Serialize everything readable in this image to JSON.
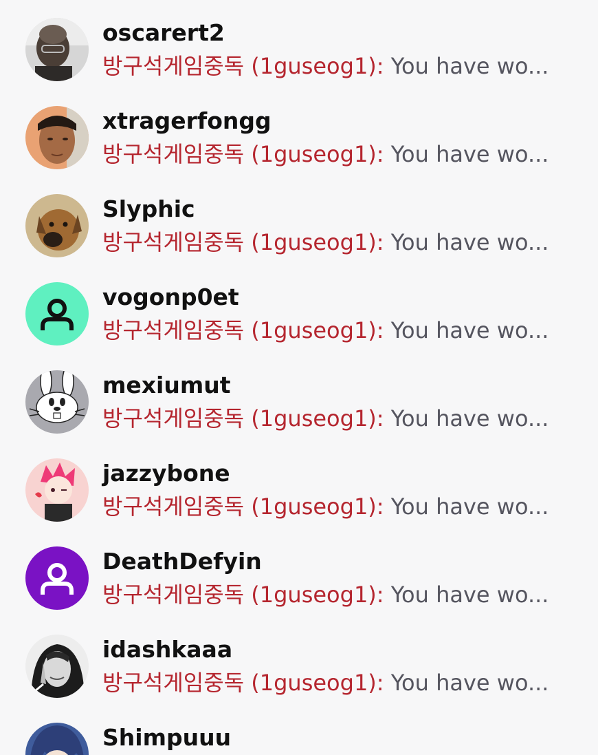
{
  "colors": {
    "background": "#f7f7f8",
    "username": "#111111",
    "sender": "#b5262f",
    "message": "#55555f"
  },
  "conversations": [
    {
      "username": "oscarert2",
      "sender": "방구석게임중독 (1guseog1):",
      "message": " You have wo...",
      "avatar": {
        "icon": "person-photo-avatar",
        "bg": "#d8d8d8"
      }
    },
    {
      "username": "xtragerfongg",
      "sender": "방구석게임중독 (1guseog1):",
      "message": " You have wo...",
      "avatar": {
        "icon": "person-photo-avatar",
        "bg": "#e6a070"
      }
    },
    {
      "username": "Slyphic",
      "sender": "방구석게임중독 (1guseog1):",
      "message": " You have wo...",
      "avatar": {
        "icon": "dog-photo-avatar",
        "bg": "#c8b38a"
      }
    },
    {
      "username": "vogonp0et",
      "sender": "방구석게임중독 (1guseog1):",
      "message": " You have wo...",
      "avatar": {
        "icon": "default-user-icon",
        "bg": "#5ff0c0",
        "fg": "#111111"
      }
    },
    {
      "username": "mexiumut",
      "sender": "방구석게임중독 (1guseog1):",
      "message": " You have wo...",
      "avatar": {
        "icon": "bunny-cartoon-avatar",
        "bg": "#a8a8ae"
      }
    },
    {
      "username": "jazzybone",
      "sender": "방구석게임중독 (1guseog1):",
      "message": " You have wo...",
      "avatar": {
        "icon": "anime-character-avatar",
        "bg": "#f8d4d2"
      }
    },
    {
      "username": "DeathDefyin",
      "sender": "방구석게임중독 (1guseog1):",
      "message": " You have wo...",
      "avatar": {
        "icon": "default-user-icon",
        "bg": "#7a12c4",
        "fg": "#ffffff"
      }
    },
    {
      "username": "idashkaaa",
      "sender": "방구석게임중독 (1guseog1):",
      "message": " You have wo...",
      "avatar": {
        "icon": "portrait-photo-avatar",
        "bg": "#e8e8e8"
      }
    },
    {
      "username": "Shimpuuu",
      "sender": "",
      "message": "",
      "avatar": {
        "icon": "anime-character-avatar",
        "bg": "#3e5b9a"
      }
    }
  ]
}
